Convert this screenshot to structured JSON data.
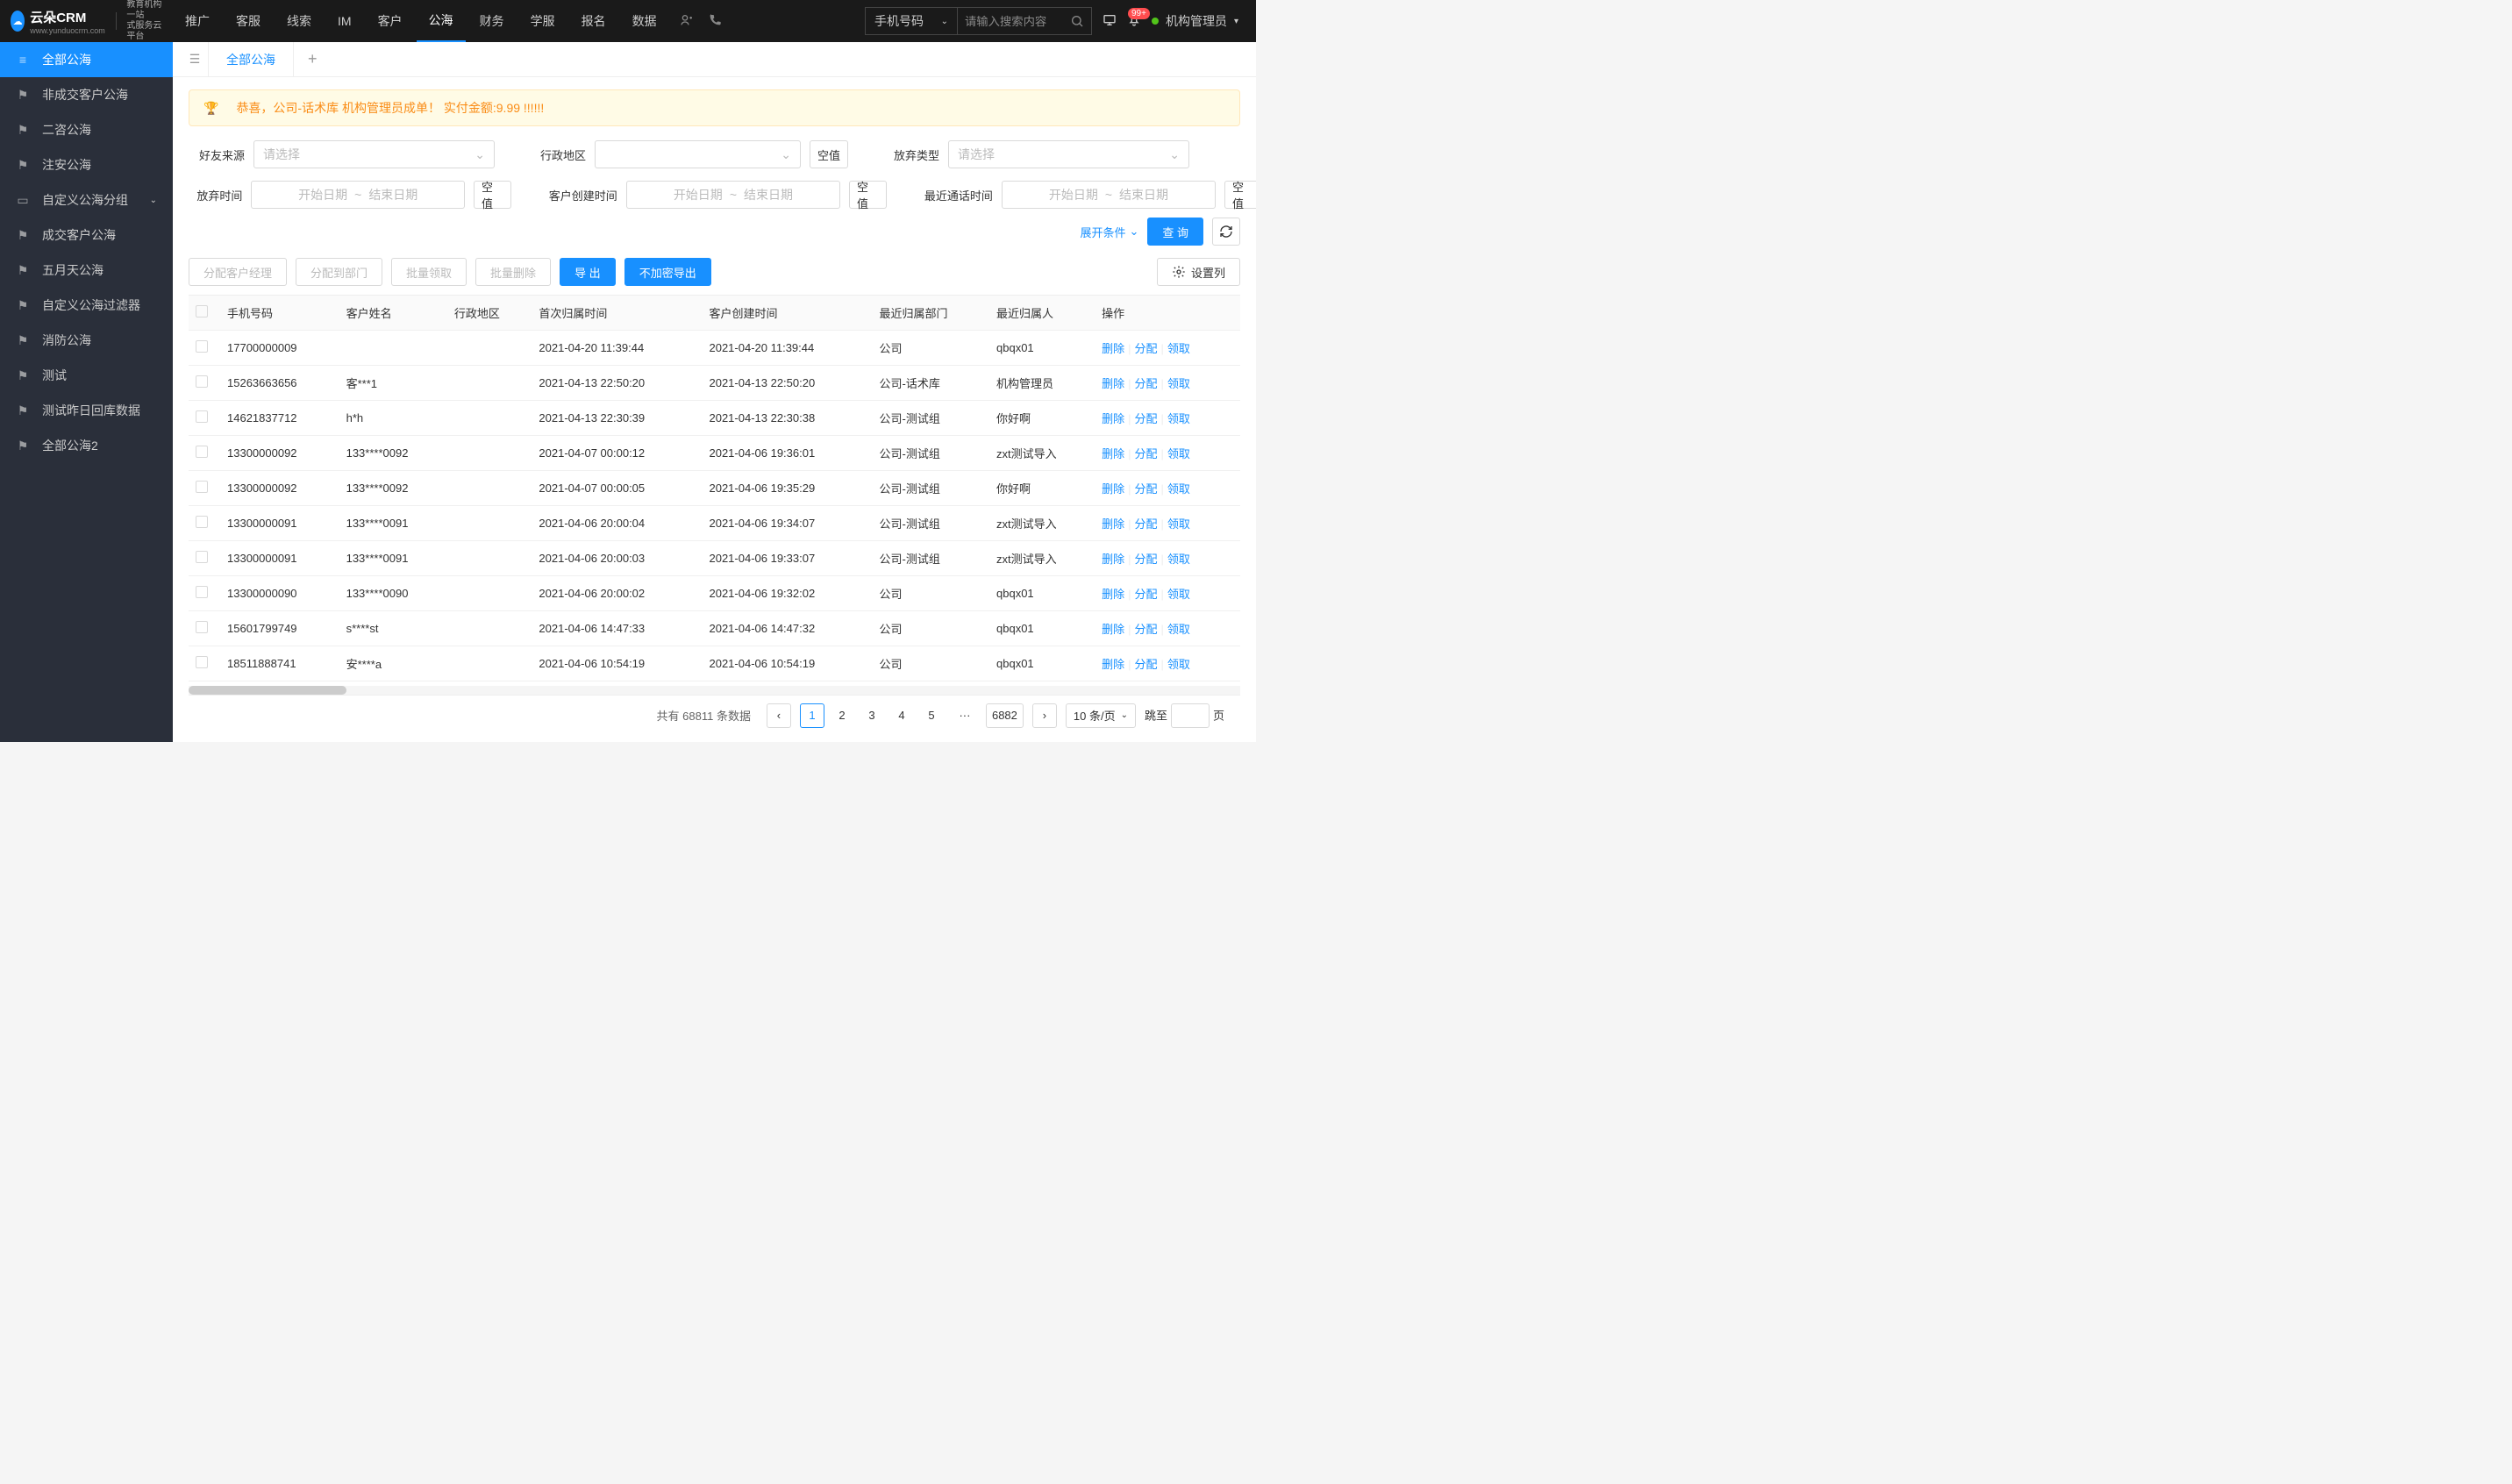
{
  "logo": {
    "brand": "云朵CRM",
    "url": "www.yunduocrm.com",
    "sub1": "教育机构一站",
    "sub2": "式服务云平台"
  },
  "top_nav": [
    "推广",
    "客服",
    "线索",
    "IM",
    "客户",
    "公海",
    "财务",
    "学服",
    "报名",
    "数据"
  ],
  "top_nav_active": 5,
  "search": {
    "type": "手机号码",
    "placeholder": "请输入搜索内容"
  },
  "notif_badge": "99+",
  "user_name": "机构管理员",
  "sidebar": [
    {
      "label": "全部公海",
      "ico": "≡"
    },
    {
      "label": "非成交客户公海",
      "ico": "⚑"
    },
    {
      "label": "二咨公海",
      "ico": "⚑"
    },
    {
      "label": "注安公海",
      "ico": "⚑"
    },
    {
      "label": "自定义公海分组",
      "ico": "▭",
      "expand": true
    },
    {
      "label": "成交客户公海",
      "ico": "⚑"
    },
    {
      "label": "五月天公海",
      "ico": "⚑"
    },
    {
      "label": "自定义公海过滤器",
      "ico": "⚑"
    },
    {
      "label": "消防公海",
      "ico": "⚑"
    },
    {
      "label": "测试",
      "ico": "⚑"
    },
    {
      "label": "测试昨日回库数据",
      "ico": "⚑"
    },
    {
      "label": "全部公海2",
      "ico": "⚑"
    }
  ],
  "sidebar_active": 0,
  "tab_label": "全部公海",
  "banner_text": "恭喜，公司-话术库  机构管理员成单！  实付金额:9.99 !!!!!!",
  "filters": {
    "friend_source": {
      "label": "好友来源",
      "placeholder": "请选择"
    },
    "region": {
      "label": "行政地区",
      "placeholder": ""
    },
    "region_empty": "空值",
    "abandon_type": {
      "label": "放弃类型",
      "placeholder": "请选择"
    },
    "abandon_time": {
      "label": "放弃时间",
      "start": "开始日期",
      "end": "结束日期",
      "empty": "空值"
    },
    "create_time": {
      "label": "客户创建时间",
      "start": "开始日期",
      "end": "结束日期",
      "empty": "空值"
    },
    "call_time": {
      "label": "最近通话时间",
      "start": "开始日期",
      "end": "结束日期",
      "empty": "空值"
    }
  },
  "expand_label": "展开条件",
  "query_label": "查 询",
  "toolbar": {
    "assign_mgr": "分配客户经理",
    "assign_dept": "分配到部门",
    "batch_claim": "批量领取",
    "batch_del": "批量删除",
    "export": "导 出",
    "export_plain": "不加密导出",
    "set_cols": "设置列"
  },
  "columns": [
    "手机号码",
    "客户姓名",
    "行政地区",
    "首次归属时间",
    "客户创建时间",
    "最近归属部门",
    "最近归属人",
    "操作"
  ],
  "actions": {
    "del": "删除",
    "assign": "分配",
    "claim": "领取"
  },
  "rows": [
    {
      "phone": "17700000009",
      "name": "",
      "region": "",
      "first": "2021-04-20 11:39:44",
      "created": "2021-04-20 11:39:44",
      "dept": "公司",
      "owner": "qbqx01"
    },
    {
      "phone": "15263663656",
      "name": "客***1",
      "region": "",
      "first": "2021-04-13 22:50:20",
      "created": "2021-04-13 22:50:20",
      "dept": "公司-话术库",
      "owner": "机构管理员"
    },
    {
      "phone": "14621837712",
      "name": "h*h",
      "region": "",
      "first": "2021-04-13 22:30:39",
      "created": "2021-04-13 22:30:38",
      "dept": "公司-测试组",
      "owner": "你好啊"
    },
    {
      "phone": "13300000092",
      "name": "133****0092",
      "region": "",
      "first": "2021-04-07 00:00:12",
      "created": "2021-04-06 19:36:01",
      "dept": "公司-测试组",
      "owner": "zxt测试导入"
    },
    {
      "phone": "13300000092",
      "name": "133****0092",
      "region": "",
      "first": "2021-04-07 00:00:05",
      "created": "2021-04-06 19:35:29",
      "dept": "公司-测试组",
      "owner": "你好啊"
    },
    {
      "phone": "13300000091",
      "name": "133****0091",
      "region": "",
      "first": "2021-04-06 20:00:04",
      "created": "2021-04-06 19:34:07",
      "dept": "公司-测试组",
      "owner": "zxt测试导入"
    },
    {
      "phone": "13300000091",
      "name": "133****0091",
      "region": "",
      "first": "2021-04-06 20:00:03",
      "created": "2021-04-06 19:33:07",
      "dept": "公司-测试组",
      "owner": "zxt测试导入"
    },
    {
      "phone": "13300000090",
      "name": "133****0090",
      "region": "",
      "first": "2021-04-06 20:00:02",
      "created": "2021-04-06 19:32:02",
      "dept": "公司",
      "owner": "qbqx01"
    },
    {
      "phone": "15601799749",
      "name": "s****st",
      "region": "",
      "first": "2021-04-06 14:47:33",
      "created": "2021-04-06 14:47:32",
      "dept": "公司",
      "owner": "qbqx01"
    },
    {
      "phone": "18511888741",
      "name": "安****a",
      "region": "",
      "first": "2021-04-06 10:54:19",
      "created": "2021-04-06 10:54:19",
      "dept": "公司",
      "owner": "qbqx01"
    }
  ],
  "pagination": {
    "total_label": "共有",
    "total": "68811",
    "unit": "条数据",
    "pages": [
      "1",
      "2",
      "3",
      "4",
      "5"
    ],
    "ellipsis": "···",
    "last": "6882",
    "size": "10 条/页",
    "jump_label": "跳至",
    "jump_unit": "页"
  }
}
